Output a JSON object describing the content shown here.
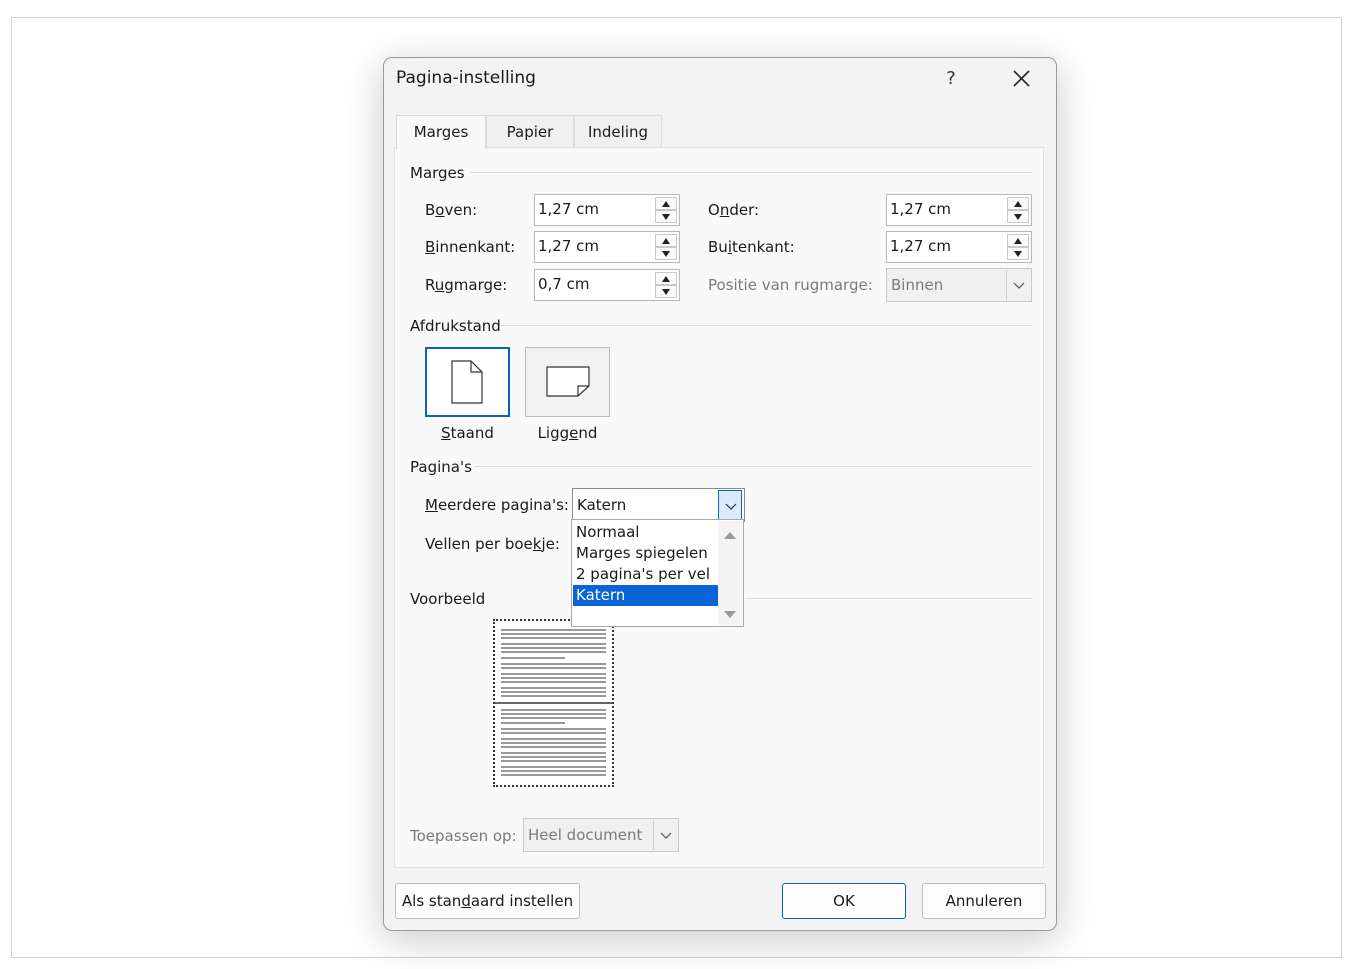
{
  "dialog": {
    "title": "Pagina-instelling",
    "help_label": "?",
    "tabs": [
      {
        "label": "Marges",
        "active": true
      },
      {
        "label": "Papier",
        "active": false
      },
      {
        "label": "Indeling",
        "active": false
      }
    ]
  },
  "margins": {
    "group_label": "Marges",
    "top": {
      "label_pre": "B",
      "label_u": "o",
      "label_post": "ven:",
      "value": "1,27 cm"
    },
    "bottom": {
      "label_pre": "O",
      "label_u": "n",
      "label_post": "der:",
      "value": "1,27 cm"
    },
    "inside": {
      "label_pre": "",
      "label_u": "B",
      "label_post": "innenkant:",
      "value": "1,27 cm"
    },
    "outside": {
      "label_pre": "Bu",
      "label_u": "i",
      "label_post": "tenkant:",
      "value": "1,27 cm"
    },
    "gutter": {
      "label_pre": "R",
      "label_u": "u",
      "label_post": "gmarge:",
      "value": "0,7 cm"
    },
    "gutter_position": {
      "label": "Positie van rugmarge:",
      "value": "Binnen"
    }
  },
  "orientation": {
    "group_label": "Afdrukstand",
    "portrait": {
      "label_pre": "",
      "label_u": "S",
      "label_post": "taand",
      "selected": true
    },
    "landscape": {
      "label_pre": "Ligg",
      "label_u": "e",
      "label_post": "nd",
      "selected": false
    }
  },
  "pages": {
    "group_label": "Pagina's",
    "multiple_pages": {
      "label_pre": "",
      "label_u": "M",
      "label_post": "eerdere pagina's:",
      "value": "Katern"
    },
    "sheets_per_booklet": {
      "label_pre": "Vellen per boe",
      "label_u": "k",
      "label_post": "je:"
    },
    "options": [
      "Normaal",
      "Marges spiegelen",
      "2 pagina's per vel",
      "Katern"
    ],
    "selected_option": "Katern"
  },
  "preview": {
    "group_label": "Voorbeeld"
  },
  "apply": {
    "label": "Toepassen op:",
    "value": "Heel document"
  },
  "buttons": {
    "default_pre": "Als stan",
    "default_u": "d",
    "default_post": "aard instellen",
    "ok": "OK",
    "cancel": "Annuleren"
  },
  "colors": {
    "accent": "#0a64d6",
    "selection": "#0a64d6"
  }
}
